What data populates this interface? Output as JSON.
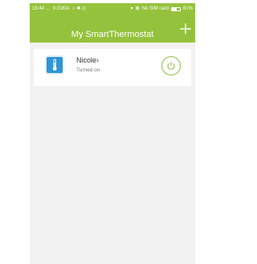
{
  "status_bar": {
    "time": "15:44",
    "ellipsis": "...",
    "network_speed": "0.01K/s",
    "indicator_glyphs": "∩ ✱ ◴",
    "wifi_glyph": "▾",
    "sim_glyph": "⊠",
    "sim_text": "No SIM card",
    "battery_percent": "61%",
    "battery_level": 0.61
  },
  "header": {
    "title": "My SmartThermostat",
    "add_label": "+"
  },
  "devices": [
    {
      "name": "Nicole",
      "chevron": "›",
      "status": "Turned on"
    }
  ],
  "colors": {
    "accent": "#95c23d",
    "background": "#f2f2f2",
    "card": "#ffffff",
    "device_icon": "#2f95d6",
    "power_ring": "#8fbe4a"
  },
  "icons": {
    "add": "plus-icon",
    "device": "thermometer-icon",
    "power": "power-icon",
    "wifi": "wifi-icon",
    "sim": "sim-icon",
    "battery": "battery-icon"
  }
}
